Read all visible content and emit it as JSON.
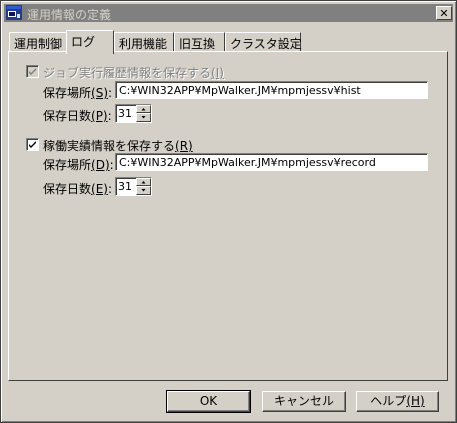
{
  "window": {
    "title": "運用情報の定義",
    "close_glyph": "✕"
  },
  "tabs": [
    {
      "label": "運用制御",
      "active": false
    },
    {
      "label": "ログ",
      "active": true
    },
    {
      "label": "利用機能",
      "active": false
    },
    {
      "label": "旧互換",
      "active": false
    },
    {
      "label": "クラスタ設定",
      "active": false
    }
  ],
  "job_history": {
    "checkbox_label": "ジョブ実行履歴情報を保存する",
    "checkbox_accel": "(I)",
    "checked": true,
    "enabled": false,
    "location_label": "保存場所",
    "location_accel": "(S)",
    "location_colon": ":",
    "location_value": "C:¥WIN32APP¥MpWalker.JM¥mpmjessv¥hist",
    "days_label": "保存日数",
    "days_accel": "(P)",
    "days_colon": ":",
    "days_value": "31"
  },
  "operation_results": {
    "checkbox_label": "稼働実績情報を保存する",
    "checkbox_accel": "(R)",
    "checked": true,
    "enabled": true,
    "location_label": "保存場所",
    "location_accel": "(D)",
    "location_colon": ":",
    "location_value": "C:¥WIN32APP¥MpWalker.JM¥mpmjessv¥record",
    "days_label": "保存日数",
    "days_accel": "(E)",
    "days_colon": ":",
    "days_value": "31"
  },
  "buttons": {
    "ok": "OK",
    "cancel": "キャンセル",
    "help_label": "ヘルプ",
    "help_accel": "(H)"
  },
  "icons": {
    "app": "app-window-icon",
    "close": "close-icon",
    "check": "checkmark-icon",
    "spin_up": "spin-up-arrow-icon",
    "spin_down": "spin-down-arrow-icon"
  }
}
